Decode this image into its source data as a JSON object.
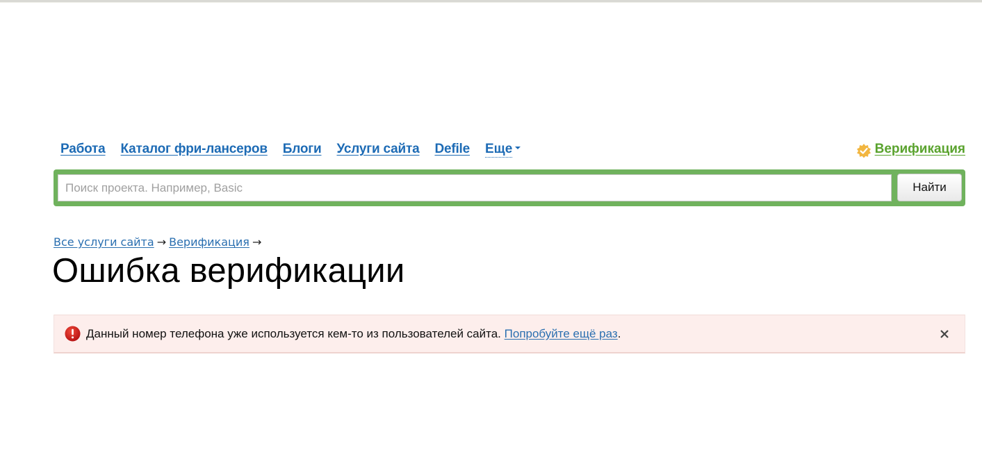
{
  "nav": {
    "items": [
      {
        "label": "Работа"
      },
      {
        "label": "Каталог фри-лансеров"
      },
      {
        "label": "Блоги"
      },
      {
        "label": "Услуги сайта"
      },
      {
        "label": "Defile"
      }
    ],
    "more_label": "Еще",
    "verification_label": "Верификация",
    "verification_icon": "verified-badge-icon"
  },
  "search": {
    "value": "",
    "placeholder": "Поиск проекта. Например, Basic",
    "button_label": "Найти"
  },
  "breadcrumb": {
    "items": [
      {
        "label": "Все услуги сайта"
      },
      {
        "label": "Верификация"
      }
    ],
    "separator": "→"
  },
  "page": {
    "title": "Ошибка верификации"
  },
  "alert": {
    "icon": "error-icon",
    "message": "Данный номер телефона уже используется кем-то из пользователей сайта.",
    "link_label": "Попробуйте ещё раз",
    "trailing": ".",
    "close_icon": "close-icon"
  },
  "colors": {
    "link": "#1d6bb5",
    "accent_green": "#70b25d",
    "verify_green": "#5aa32e",
    "alert_bg": "#fdeeec",
    "error_red": "#d32222"
  }
}
